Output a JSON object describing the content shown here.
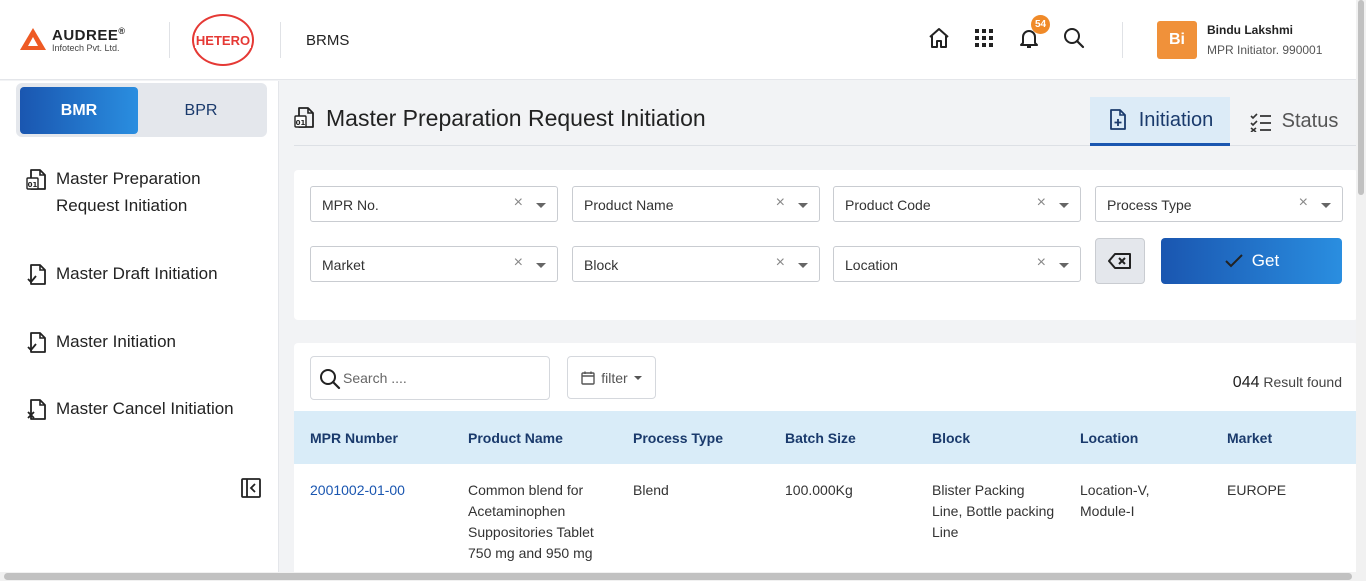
{
  "header": {
    "logo_audree": "AUDREE",
    "logo_audree_sub": "Infotech Pvt. Ltd.",
    "logo_reg": "®",
    "logo_hetero": "HETERO",
    "app_name": "BRMS",
    "notification_count": "54",
    "user": {
      "initials": "Bi",
      "name": "Bindu Lakshmi",
      "role": "MPR Initiator. 990001",
      "avatar_color": "#f0913a"
    },
    "icons": [
      "home-icon",
      "apps-grid-icon",
      "bell-icon",
      "search-icon"
    ]
  },
  "sidebar": {
    "toggle": {
      "bmr": "BMR",
      "bpr": "BPR",
      "active": "BMR"
    },
    "items": [
      {
        "label": "Master Preparation Request Initiation",
        "icon": "document-01-icon"
      },
      {
        "label": "Master Draft Initiation",
        "icon": "document-check-icon"
      },
      {
        "label": "Master Initiation",
        "icon": "document-check-icon"
      },
      {
        "label": "Master Cancel Initiation",
        "icon": "document-cancel-icon"
      }
    ]
  },
  "page": {
    "title": "Master Preparation Request Initiation",
    "tabs": {
      "initiation": "Initiation",
      "status": "Status",
      "active": "Initiation"
    }
  },
  "filters": {
    "mpr_no": "MPR No.",
    "product_name": "Product Name",
    "product_code": "Product Code",
    "process_type": "Process Type",
    "market": "Market",
    "block": "Block",
    "location": "Location",
    "clear_symbol": "×",
    "get_label": "Get"
  },
  "table": {
    "search_placeholder": "Search ....",
    "filter_label": "filter",
    "result_count": "044",
    "result_text": "Result found",
    "columns": [
      "MPR Number",
      "Product Name",
      "Process Type",
      "Batch Size",
      "Block",
      "Location",
      "Market"
    ],
    "rows": [
      {
        "mpr_number": "2001002-01-00",
        "product_name": "Common blend for Acetaminophen Suppositories Tablet 750 mg and 950 mg",
        "process_type": "Blend",
        "batch_size": "100.000Kg",
        "block": "Blister Packing Line, Bottle packing Line",
        "location": "Location-V, Module-I",
        "market": "EUROPE"
      }
    ]
  },
  "colors": {
    "primary": "#1a56b0",
    "primary_light": "#2a8ee0",
    "accent": "#f08a28",
    "table_header_bg": "#d9ecf8"
  }
}
